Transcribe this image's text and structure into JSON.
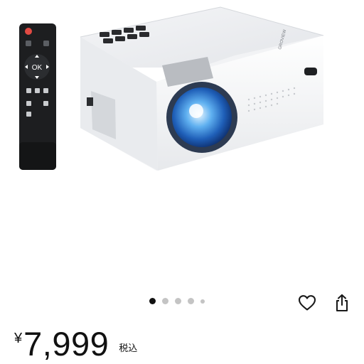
{
  "product": {
    "brand_label": "GROVIEW",
    "remote_ok_label": "OK"
  },
  "carousel": {
    "total": 5,
    "active_index": 0
  },
  "price": {
    "currency": "¥",
    "amount": "7,999",
    "tax_label": "税込"
  },
  "actions": {
    "favorite_icon": "heart-outline-icon",
    "share_icon": "share-icon"
  }
}
